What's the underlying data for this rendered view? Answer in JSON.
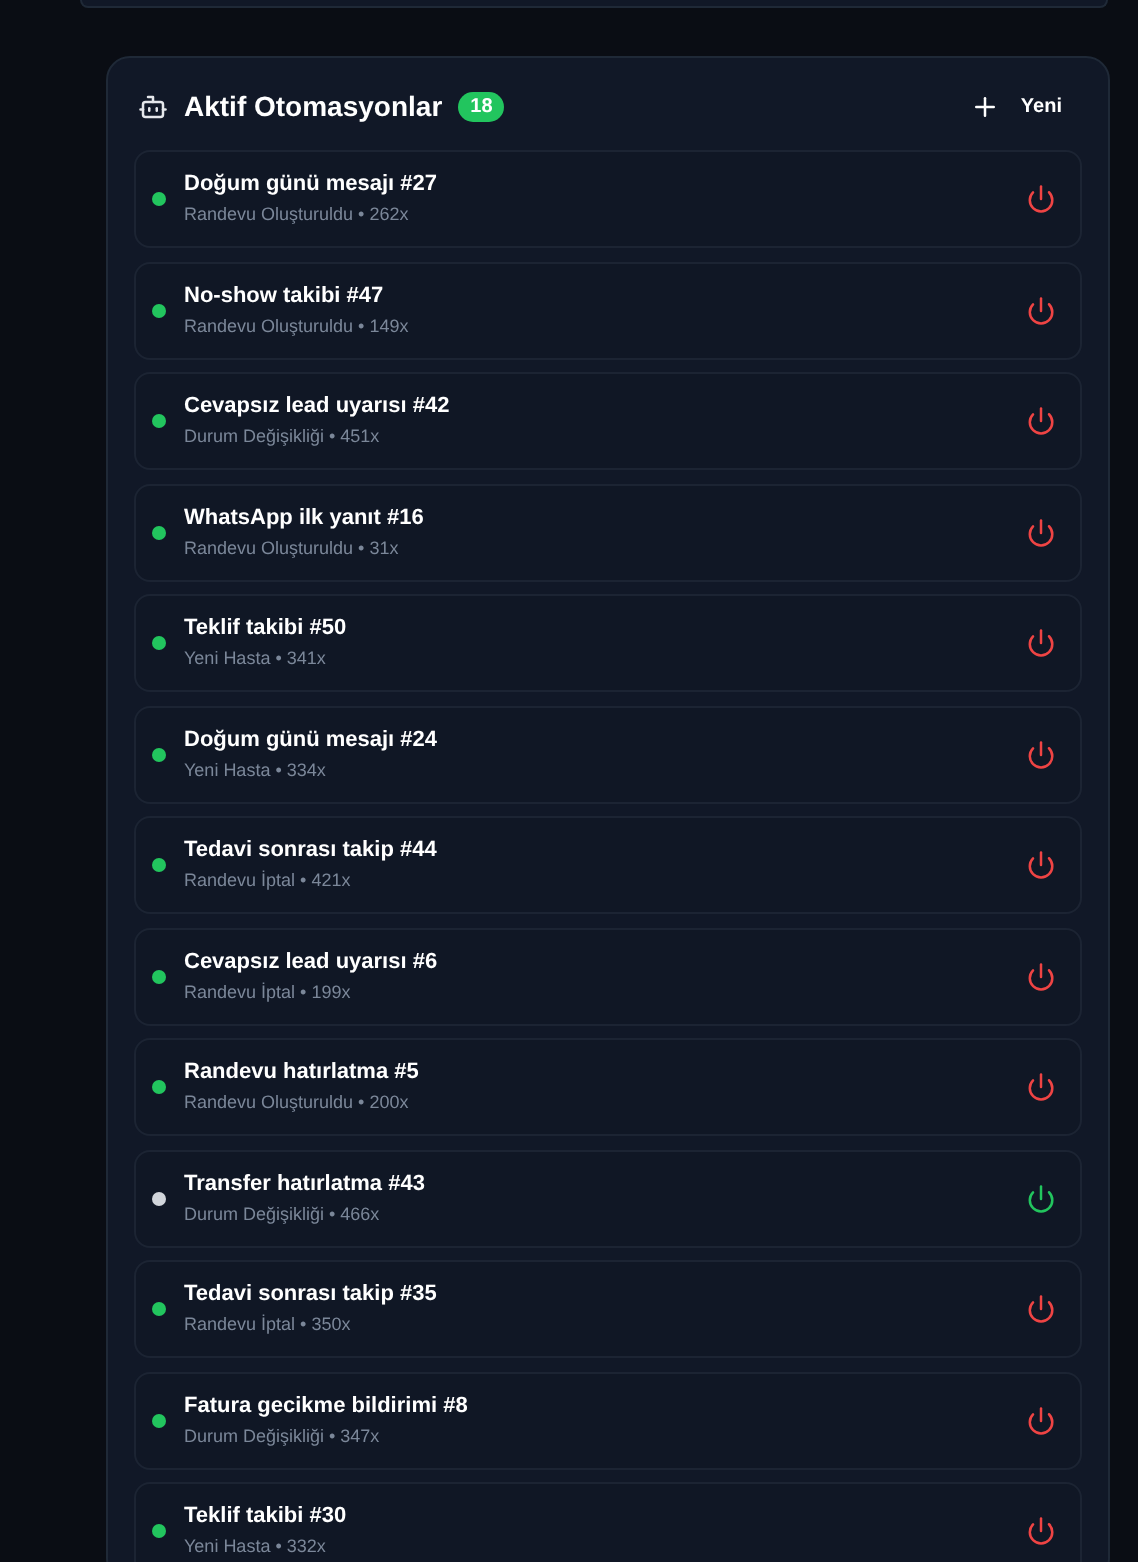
{
  "panel": {
    "title": "Aktif Otomasyonlar",
    "count": "18",
    "new_button": "Yeni"
  },
  "automations": [
    {
      "name": "Doğum günü mesajı #27",
      "detail": "Randevu Oluşturuldu • 262x",
      "active": true
    },
    {
      "name": "No-show takibi #47",
      "detail": "Randevu Oluşturuldu • 149x",
      "active": true
    },
    {
      "name": "Cevapsız lead uyarısı #42",
      "detail": "Durum Değişikliği • 451x",
      "active": true
    },
    {
      "name": "WhatsApp ilk yanıt #16",
      "detail": "Randevu Oluşturuldu • 31x",
      "active": true
    },
    {
      "name": "Teklif takibi #50",
      "detail": "Yeni Hasta • 341x",
      "active": true
    },
    {
      "name": "Doğum günü mesajı #24",
      "detail": "Yeni Hasta • 334x",
      "active": true
    },
    {
      "name": "Tedavi sonrası takip #44",
      "detail": "Randevu İptal • 421x",
      "active": true
    },
    {
      "name": "Cevapsız lead uyarısı #6",
      "detail": "Randevu İptal • 199x",
      "active": true
    },
    {
      "name": "Randevu hatırlatma #5",
      "detail": "Randevu Oluşturuldu • 200x",
      "active": true
    },
    {
      "name": "Transfer hatırlatma #43",
      "detail": "Durum Değişikliği • 466x",
      "active": false
    },
    {
      "name": "Tedavi sonrası takip #35",
      "detail": "Randevu İptal • 350x",
      "active": true
    },
    {
      "name": "Fatura gecikme bildirimi #8",
      "detail": "Durum Değişikliği • 347x",
      "active": true
    },
    {
      "name": "Teklif takibi #30",
      "detail": "Yeni Hasta • 332x",
      "active": true
    }
  ]
}
